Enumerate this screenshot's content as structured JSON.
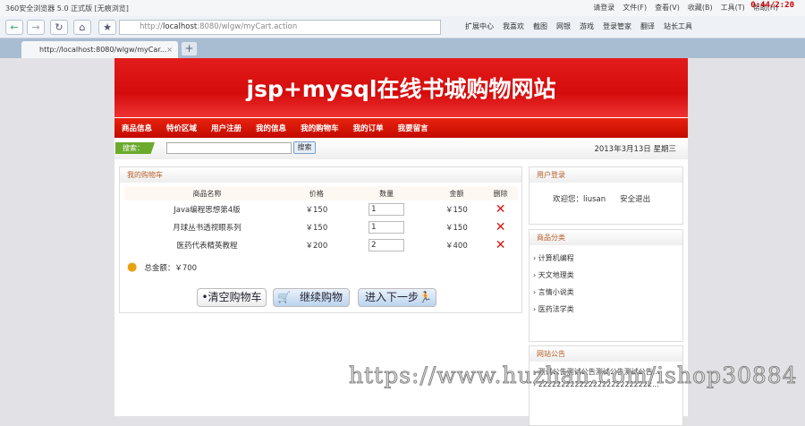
{
  "browser": {
    "title": "360安全浏览器 5.0 正式版 [无痕浏览]",
    "menus": [
      "请登录",
      "文件(F)",
      "查看(V)",
      "收藏(B)",
      "工具(T)",
      "帮助(H)"
    ],
    "clock": "0:44/2:20",
    "url_prefix": "http://",
    "url_host": "localhost",
    "url_rest": ":8080/wlgw/myCart.action",
    "extensions": [
      "扩展中心",
      "我喜欢",
      "截图",
      "网银",
      "游戏",
      "登录管家",
      "翻译",
      "站长工具"
    ],
    "tab_title": "http://localhost:8080/wlgw/myCar...",
    "tab_close": "×",
    "tab_add": "+"
  },
  "site": {
    "title": "jsp+mysql在线书城购物网站",
    "nav": [
      "商品信息",
      "特价区域",
      "用户注册",
      "我的信息",
      "我的购物车",
      "我的订单",
      "我要留言"
    ],
    "search_label": "搜索：",
    "search_button": "搜索",
    "date": "2013年3月13日 星期三"
  },
  "cart": {
    "heading": "我的购物车",
    "columns": [
      "商品名称",
      "价格",
      "数量",
      "金额",
      "删除"
    ],
    "rows": [
      {
        "name": "Java编程思想第4版",
        "price": "￥150",
        "qty": "1",
        "amount": "￥150"
      },
      {
        "name": "月球丛书透视眼系列",
        "price": "￥150",
        "qty": "1",
        "amount": "￥150"
      },
      {
        "name": "医药代表精英教程",
        "price": "￥200",
        "qty": "2",
        "amount": "￥400"
      }
    ],
    "total": "总金额：￥700",
    "clear_button": "•清空购物车",
    "continue_button": "继续购物",
    "next_button": "进入下一步"
  },
  "login": {
    "heading": "用户登录",
    "welcome": "欢迎您：liusan",
    "logout": "安全退出"
  },
  "categories": {
    "heading": "商品分类",
    "items": [
      "计算机编程",
      "天文地理类",
      "言情小说类",
      "医药法学类"
    ]
  },
  "notice": {
    "heading": "网站公告",
    "items": [
      "测试公告测试公告测试公告测试公告...",
      "2222222222222222222222222..."
    ]
  },
  "watermark": "https://www.huzhan.com/ishop30884"
}
